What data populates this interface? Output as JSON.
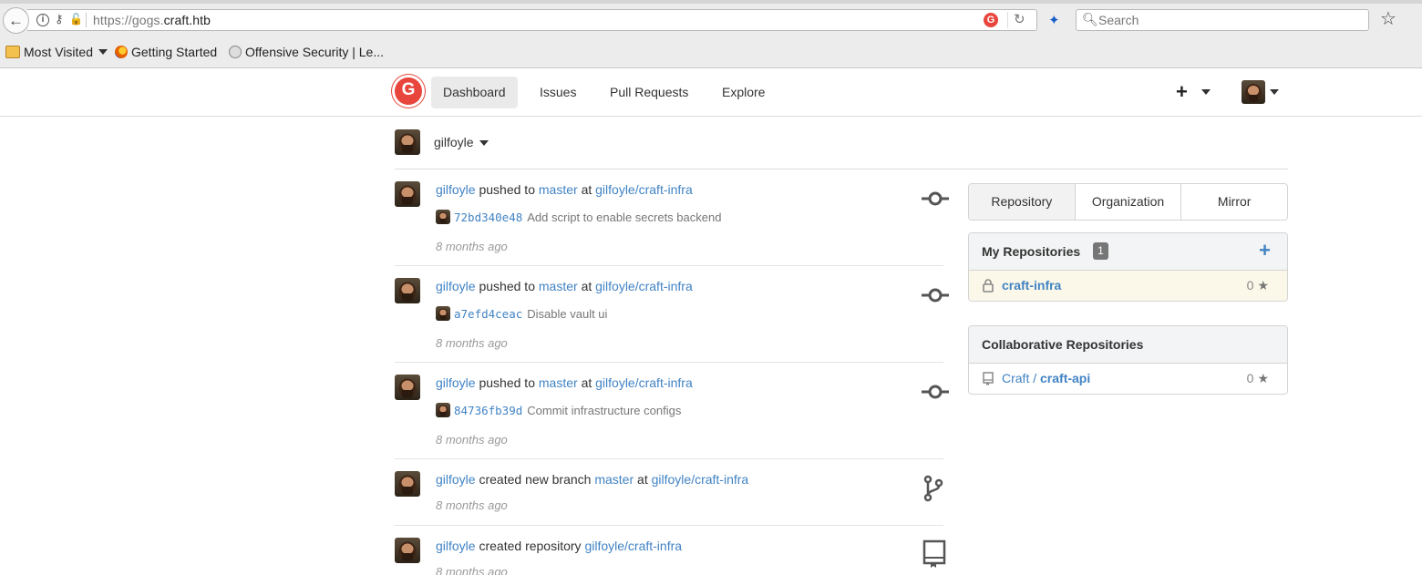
{
  "browser": {
    "url_prefix": "https://gogs.",
    "url_domain": "craft.htb",
    "search_placeholder": "Search",
    "bookmarks": [
      {
        "label": "Most Visited"
      },
      {
        "label": "Getting Started"
      },
      {
        "label": "Offensive Security | Le..."
      }
    ]
  },
  "nav": {
    "items": [
      {
        "label": "Dashboard"
      },
      {
        "label": "Issues"
      },
      {
        "label": "Pull Requests"
      },
      {
        "label": "Explore"
      }
    ],
    "plus": "+"
  },
  "context": {
    "user": "gilfoyle"
  },
  "feed": [
    {
      "user": "gilfoyle",
      "action": "pushed to",
      "branch": "master",
      "at": "at",
      "repo": "gilfoyle/craft-infra",
      "sha": "72bd340e48",
      "message": "Add script to enable secrets backend",
      "time": "8 months ago",
      "icon": "commit-icon"
    },
    {
      "user": "gilfoyle",
      "action": "pushed to",
      "branch": "master",
      "at": "at",
      "repo": "gilfoyle/craft-infra",
      "sha": "a7efd4ceac",
      "message": "Disable vault ui",
      "time": "8 months ago",
      "icon": "commit-icon"
    },
    {
      "user": "gilfoyle",
      "action": "pushed to",
      "branch": "master",
      "at": "at",
      "repo": "gilfoyle/craft-infra",
      "sha": "84736fb39d",
      "message": "Commit infrastructure configs",
      "time": "8 months ago",
      "icon": "commit-icon"
    },
    {
      "user": "gilfoyle",
      "action": "created new branch",
      "branch": "master",
      "at": "at",
      "repo": "gilfoyle/craft-infra",
      "time": "8 months ago",
      "icon": "branch-icon"
    },
    {
      "user": "gilfoyle",
      "action": "created repository",
      "repo": "gilfoyle/craft-infra",
      "time": "8 months ago",
      "icon": "book-icon"
    }
  ],
  "sidebar": {
    "tabs": [
      {
        "label": "Repository"
      },
      {
        "label": "Organization"
      },
      {
        "label": "Mirror"
      }
    ],
    "my_repos": {
      "title": "My Repositories",
      "count": "1",
      "items": [
        {
          "name": "craft-infra",
          "stars": "0",
          "private": true
        }
      ]
    },
    "collab_repos": {
      "title": "Collaborative Repositories",
      "items": [
        {
          "owner": "Craft / ",
          "name": "craft-api",
          "stars": "0"
        }
      ]
    }
  },
  "colors": {
    "link": "#4183c4",
    "gogs_red": "#e8453c",
    "highlight_row": "#fbf8e9"
  }
}
